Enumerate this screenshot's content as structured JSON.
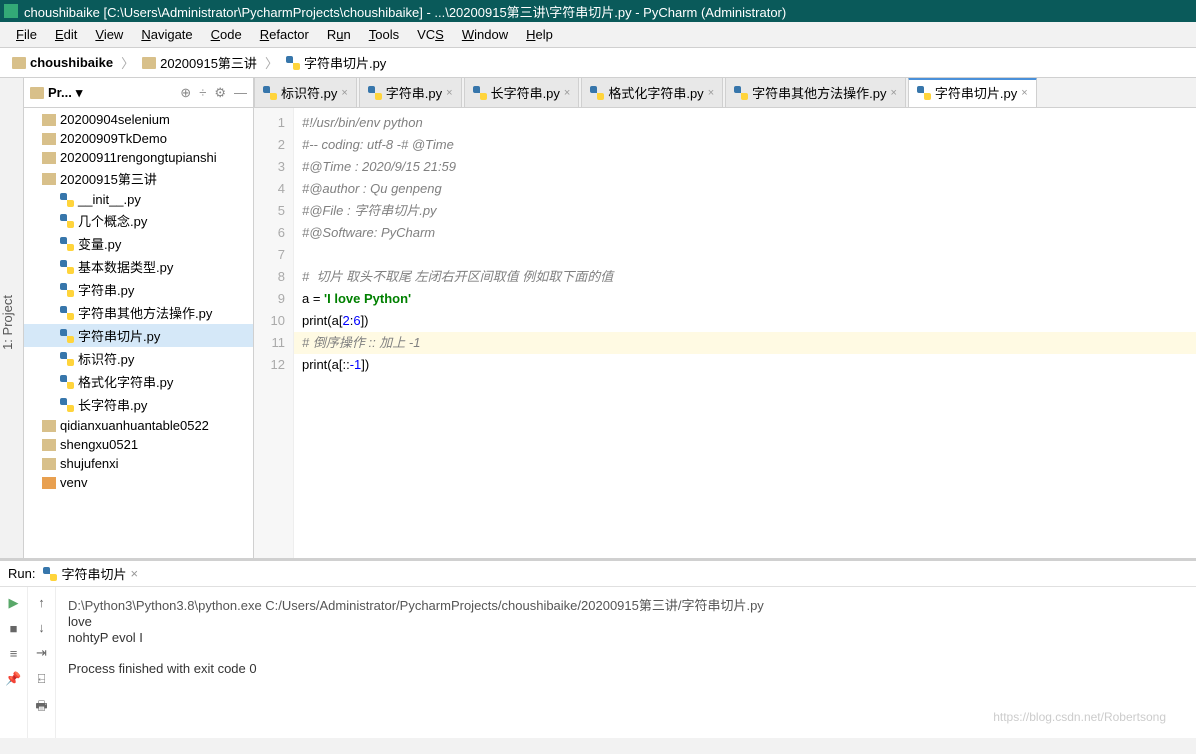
{
  "title": "choushibaike [C:\\Users\\Administrator\\PycharmProjects\\choushibaike] - ...\\20200915第三讲\\字符串切片.py - PyCharm (Administrator)",
  "menu": [
    "File",
    "Edit",
    "View",
    "Navigate",
    "Code",
    "Refactor",
    "Run",
    "Tools",
    "VCS",
    "Window",
    "Help"
  ],
  "crumbs": [
    "choushibaike",
    "20200915第三讲",
    "字符串切片.py"
  ],
  "sidebar_label": "1: Project",
  "project_panel": {
    "label": "Pr...",
    "tools": [
      "⊕",
      "÷",
      "⚙",
      "—"
    ]
  },
  "tree": [
    {
      "t": "folder",
      "label": "20200904selenium",
      "lvl": "folder"
    },
    {
      "t": "folder",
      "label": "20200909TkDemo",
      "lvl": "folder"
    },
    {
      "t": "folder",
      "label": "20200911rengongtupianshi",
      "lvl": "folder"
    },
    {
      "t": "folder",
      "label": "20200915第三讲",
      "lvl": "folder"
    },
    {
      "t": "py",
      "label": "__init__.py",
      "lvl": "sub"
    },
    {
      "t": "py",
      "label": "几个概念.py",
      "lvl": "sub"
    },
    {
      "t": "py",
      "label": "变量.py",
      "lvl": "sub"
    },
    {
      "t": "py",
      "label": "基本数据类型.py",
      "lvl": "sub"
    },
    {
      "t": "py",
      "label": "字符串.py",
      "lvl": "sub"
    },
    {
      "t": "py",
      "label": "字符串其他方法操作.py",
      "lvl": "sub"
    },
    {
      "t": "py",
      "label": "字符串切片.py",
      "lvl": "sub",
      "sel": true
    },
    {
      "t": "py",
      "label": "标识符.py",
      "lvl": "sub"
    },
    {
      "t": "py",
      "label": "格式化字符串.py",
      "lvl": "sub"
    },
    {
      "t": "py",
      "label": "长字符串.py",
      "lvl": "sub"
    },
    {
      "t": "folder",
      "label": "qidianxuanhuantable0522",
      "lvl": "folder"
    },
    {
      "t": "folder",
      "label": "shengxu0521",
      "lvl": "folder"
    },
    {
      "t": "folder",
      "label": "shujufenxi",
      "lvl": "folder"
    },
    {
      "t": "venv",
      "label": "venv",
      "lvl": "folder"
    }
  ],
  "tabs": [
    {
      "label": "标识符.py"
    },
    {
      "label": "字符串.py"
    },
    {
      "label": "长字符串.py"
    },
    {
      "label": "格式化字符串.py"
    },
    {
      "label": "字符串其他方法操作.py"
    },
    {
      "label": "字符串切片.py",
      "active": true
    }
  ],
  "gutter": [
    "1",
    "2",
    "3",
    "4",
    "5",
    "6",
    "7",
    "8",
    "9",
    "10",
    "11",
    "12"
  ],
  "code": {
    "l1": "#!/usr/bin/env python",
    "l2": "#-- coding: utf-8 -# @Time",
    "l3": "#@Time : 2020/9/15 21:59",
    "l4": "#@author : Qu genpeng",
    "l5": "#@File : 字符串切片.py",
    "l6": "#@Software: PyCharm",
    "l8": "#  切片 取头不取尾 左闭右开区间取值 例如取下面的值",
    "l9a": "a = ",
    "l9b": "'I love Python'",
    "l10a": "print",
    "l10b": "(a[",
    "l10c": "2",
    "l10d": ":",
    "l10e": "6",
    "l10f": "])",
    "l11": "# 倒序操作 :: 加上 -1",
    "l12a": "print",
    "l12b": "(a[::",
    "l12c": "-1",
    "l12d": "])"
  },
  "run": {
    "label": "Run:",
    "tab": "字符串切片",
    "cmd": "D:\\Python3\\Python3.8\\python.exe C:/Users/Administrator/PycharmProjects/choushibaike/20200915第三讲/字符串切片.py",
    "out1": "love",
    "out2": "nohtyP evol I",
    "exit": "Process finished with exit code 0"
  },
  "watermark": "https://blog.csdn.net/Robertsong"
}
